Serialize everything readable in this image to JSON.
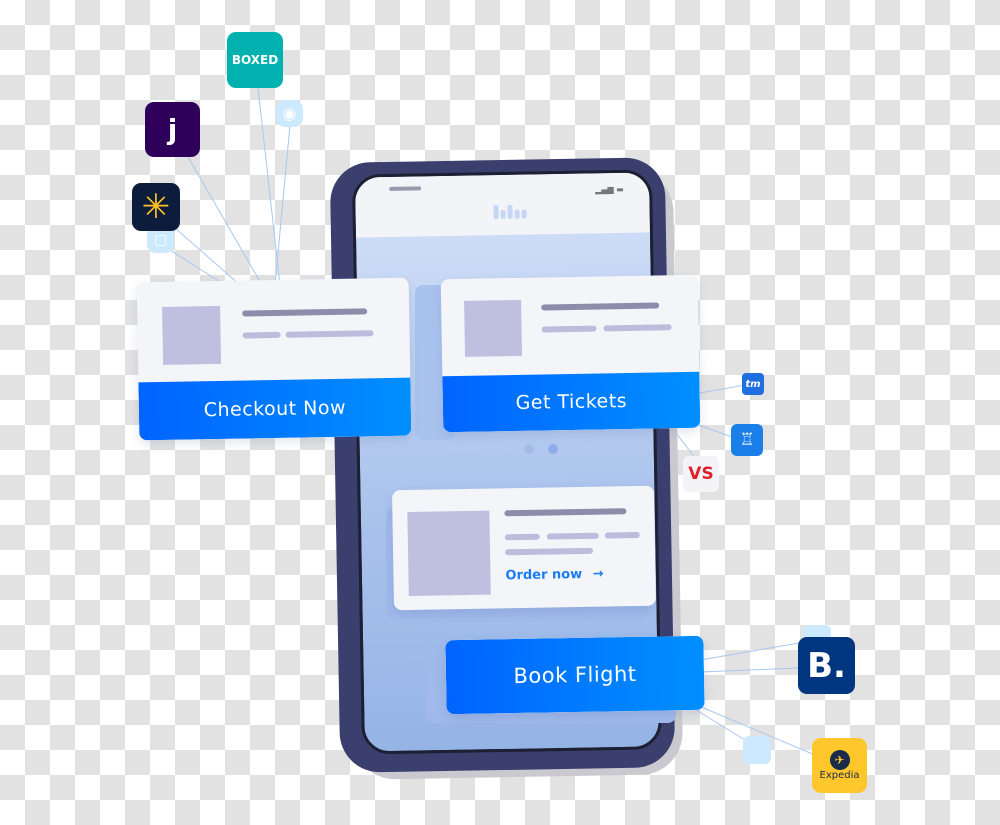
{
  "cards": {
    "checkout": {
      "button": "Checkout Now"
    },
    "tickets": {
      "button": "Get Tickets"
    },
    "order": {
      "link": "Order now",
      "arrow": "→"
    },
    "flight": {
      "button": "Book Flight"
    }
  },
  "logos": [
    {
      "name": "boxed",
      "text": "BOXED",
      "color": "#00b1b0"
    },
    {
      "name": "jet",
      "text": "j",
      "color": "#2f0059"
    },
    {
      "name": "walmart",
      "color": "#0c1c3d",
      "accent": "#ffc220"
    },
    {
      "name": "ticketmaster",
      "text": "tm",
      "color": "#1f6fe0"
    },
    {
      "name": "seatgeek",
      "color": "#1a7fe8"
    },
    {
      "name": "vividseats",
      "text": "VS",
      "color": "#e0202a"
    },
    {
      "name": "booking",
      "text": "B.",
      "color": "#003580"
    },
    {
      "name": "expedia",
      "text": "Expedia",
      "color": "#ffc72c"
    }
  ],
  "colors": {
    "accent": "#0078ff",
    "phone": "#3a3f6e"
  }
}
